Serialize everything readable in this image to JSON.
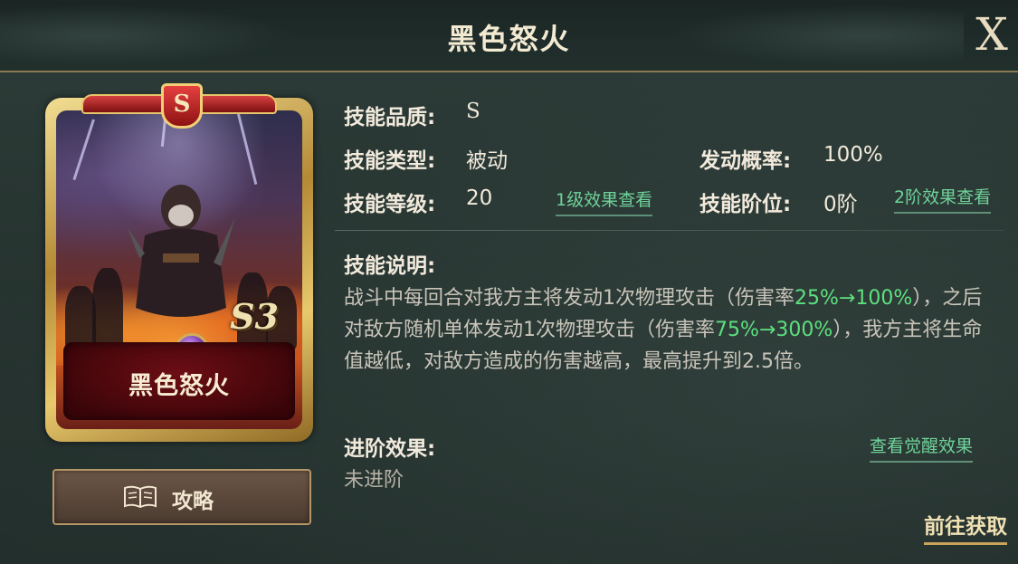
{
  "title": "黑色怒火",
  "close_label": "X",
  "card": {
    "grade_emblem": "S",
    "stage_mark": "S3",
    "name": "黑色怒火"
  },
  "guide_button": {
    "label": "攻略",
    "icon": "book-icon"
  },
  "info": {
    "quality_label": "技能品质:",
    "quality_value": "S",
    "type_label": "技能类型:",
    "type_value": "被动",
    "rate_label": "发动概率:",
    "rate_value": "100%",
    "level_label": "技能等级:",
    "level_value": "20",
    "level1_link": "1级效果查看",
    "rank_label": "技能阶位:",
    "rank_value": "0阶",
    "rank2_link": "2阶效果查看"
  },
  "description": {
    "label": "技能说明:",
    "p1": "战斗中每回合对我方主将发动1次物理攻击（伤害率",
    "h1": "25%→100%",
    "p2": "），之后对敌方随机单体发动1次物理攻击（伤害率",
    "h2": "75%→300%",
    "p3": "），我方主将生命值越低，对敌方造成的伤害越高，最高提升到2.5倍。"
  },
  "advance": {
    "label": "进阶效果:",
    "value": "未进阶",
    "awaken_link": "查看觉醒效果"
  },
  "goto_link": "前往获取",
  "colors": {
    "highlight": "#5de07f",
    "link": "#6fd39a",
    "gold": "#c9a45a"
  }
}
